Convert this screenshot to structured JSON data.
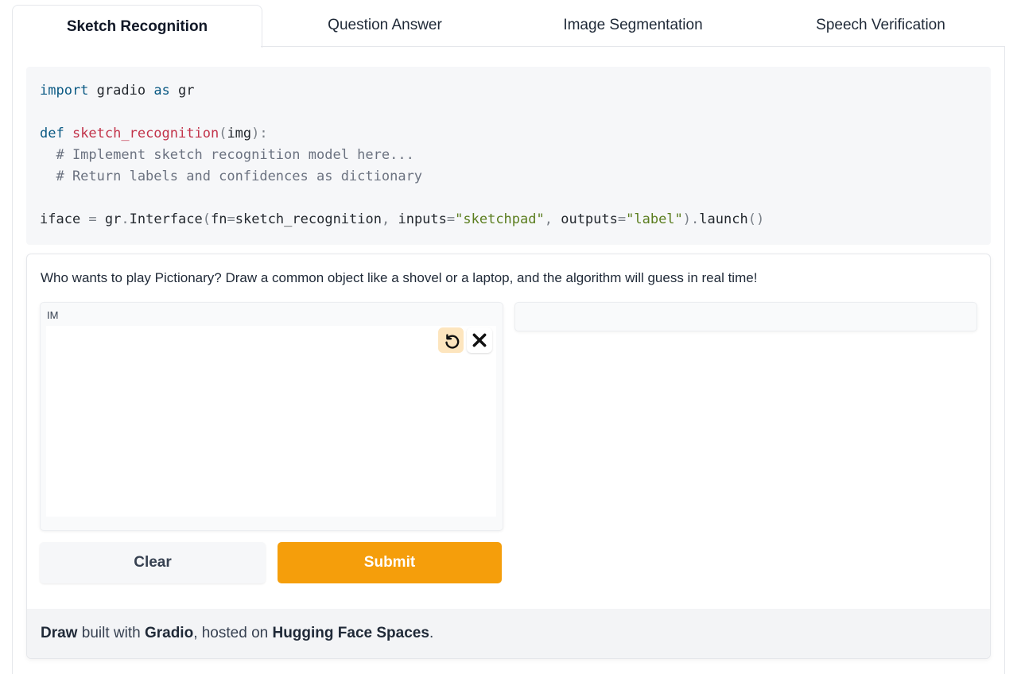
{
  "tabs": [
    "Sketch Recognition",
    "Question Answer",
    "Image Segmentation",
    "Speech Verification"
  ],
  "active_tab": "Sketch Recognition",
  "code": {
    "line1": {
      "kw1": "import",
      "mod": " gradio ",
      "kw2": "as",
      "alias": " gr"
    },
    "line2": {
      "kw": "def",
      "name": " sketch_recognition",
      "open": "(",
      "arg": "img",
      "close": "):"
    },
    "line3": "  # Implement sketch recognition model here...",
    "line4": "  # Return labels and confidences as dictionary",
    "line5": {
      "var": "iface ",
      "eq": "=",
      "call1": " gr",
      "dot1": ".",
      "call2": "Interface",
      "p1": "(",
      "arg1": "fn",
      "eq2": "=",
      "val1": "sketch_recognition",
      "comma1": ", ",
      "arg2": "inputs",
      "eq3": "=",
      "val2": "\"sketchpad\"",
      "comma2": ", ",
      "arg3": "outputs",
      "eq4": "=",
      "val3": "\"label\"",
      "p2": ")",
      "dot2": ".",
      "call3": "launch",
      "p3": "()"
    }
  },
  "demo": {
    "description": "Who wants to play Pictionary? Draw a common object like a shovel or a laptop, and the algorithm will guess in real time!",
    "input_label": "IM",
    "clear_label": "Clear",
    "submit_label": "Submit"
  },
  "footer": {
    "title": "Draw",
    "text1": " built with ",
    "gradio": "Gradio",
    "text2": ", hosted on ",
    "hf": "Hugging Face Spaces",
    "text3": "."
  },
  "colors": {
    "accent": "#f59e0b",
    "undo_bg": "#fde5be"
  },
  "icons": {
    "undo": "undo-icon",
    "close": "close-icon"
  }
}
